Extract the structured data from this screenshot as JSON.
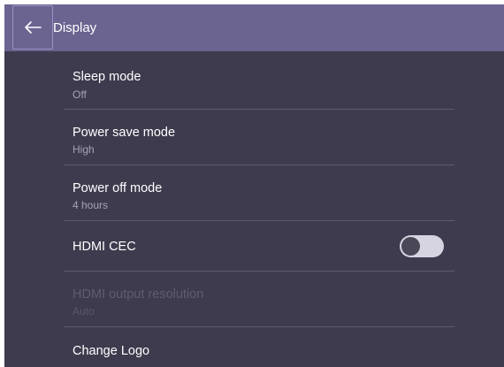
{
  "header": {
    "back_icon": "arrow-left-icon",
    "title": "Display"
  },
  "settings": [
    {
      "label": "Sleep mode",
      "value": "Off"
    },
    {
      "label": "Power save mode",
      "value": "High"
    },
    {
      "label": "Power off mode",
      "value": "4 hours"
    },
    {
      "label": "HDMI CEC",
      "toggle_on": false
    },
    {
      "label": "HDMI output resolution",
      "value": "Auto",
      "disabled": true
    },
    {
      "label": "Change Logo"
    }
  ],
  "colors": {
    "header_bg": "#6b6390",
    "panel_bg": "#3e3b4e",
    "divider": "#5e5b6e",
    "toggle_track": "#d7d4e2"
  }
}
